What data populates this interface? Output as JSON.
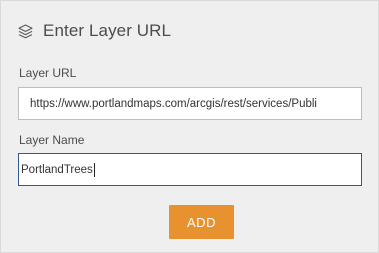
{
  "header": {
    "icon": "layers-icon",
    "title": "Enter Layer URL"
  },
  "layer_url": {
    "label": "Layer URL",
    "value": "https://www.portlandmaps.com/arcgis/rest/services/Publi"
  },
  "layer_name": {
    "label": "Layer Name",
    "value": "PortlandTrees"
  },
  "add_button": {
    "label": "ADD"
  },
  "colors": {
    "panel_background": "#efefef",
    "title_text": "#4c4c4c",
    "focused_border": "#2f5d91",
    "add_button": "#e8922f",
    "add_button_text": "#ffffff"
  }
}
